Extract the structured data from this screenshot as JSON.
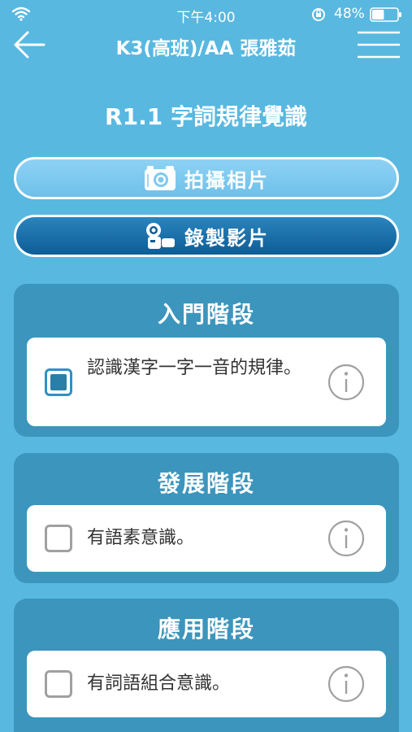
{
  "status_bar": {
    "time": "下午4:00",
    "battery_percent": "48%",
    "battery_level": 0.48
  },
  "nav": {
    "title": "K3(高班)/AA 張雅茹"
  },
  "page": {
    "title": "R1.1 字詞規律覺識"
  },
  "actions": {
    "photo_label": "拍攝相片",
    "video_label": "錄製影片"
  },
  "stages": [
    {
      "title": "入門階段",
      "item": {
        "text": "認識漢字一字一音的規律。",
        "checked": true
      }
    },
    {
      "title": "發展階段",
      "item": {
        "text": "有語素意識。",
        "checked": false
      }
    },
    {
      "title": "應用階段",
      "item": {
        "text": "有詞語組合意識。",
        "checked": false
      }
    }
  ],
  "colors": {
    "background": "#58b8e0",
    "stage_panel": "#3c95bc",
    "photo_button": "#7ec9f0",
    "video_button": "#0d5d96",
    "checked_fill": "#2a7fa8"
  }
}
